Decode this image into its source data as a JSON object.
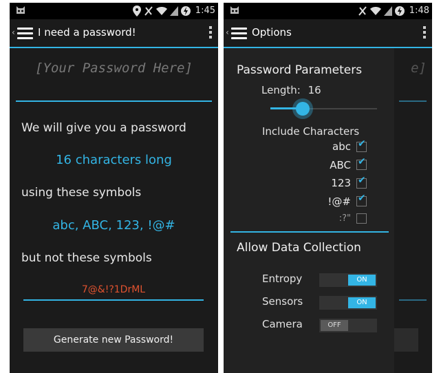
{
  "left": {
    "time": "1:45",
    "title": "I need a password!",
    "password_placeholder": "[Your Password Here]",
    "line1": "We will give you a password",
    "length_text": "16 characters long",
    "line2": "using these symbols",
    "symbols_text": "abc, ABC, 123, !@#",
    "line3": "but not these symbols",
    "excluded_input_value": "7@&!?1DrML",
    "generate_button": "Generate new Password!"
  },
  "right": {
    "time": "1:48",
    "title": "Options",
    "bg_hint": "e]",
    "password_parameters_heading": "Password Parameters",
    "length_label": "Length:",
    "length_value": "16",
    "length_fraction": 0.3,
    "include_heading": "Include Characters",
    "char_sets": [
      {
        "label": "abc",
        "checked": true
      },
      {
        "label": "ABC",
        "checked": true
      },
      {
        "label": "123",
        "checked": true
      },
      {
        "label": "!@#",
        "checked": true
      },
      {
        "label": ":?\"",
        "checked": false
      }
    ],
    "data_collection_heading": "Allow Data Collection",
    "toggles": [
      {
        "label": "Entropy",
        "state": "ON"
      },
      {
        "label": "Sensors",
        "state": "ON"
      },
      {
        "label": "Camera",
        "state": "OFF"
      }
    ]
  },
  "colors": {
    "accent": "#33b5e5",
    "password_text": "#e0522f"
  },
  "icons": [
    "android-cat-icon",
    "location-icon",
    "no-signal-icon",
    "wifi-icon",
    "signal-icon",
    "battery-icon",
    "hamburger-menu-icon",
    "overflow-menu-icon",
    "back-chevron-icon"
  ]
}
